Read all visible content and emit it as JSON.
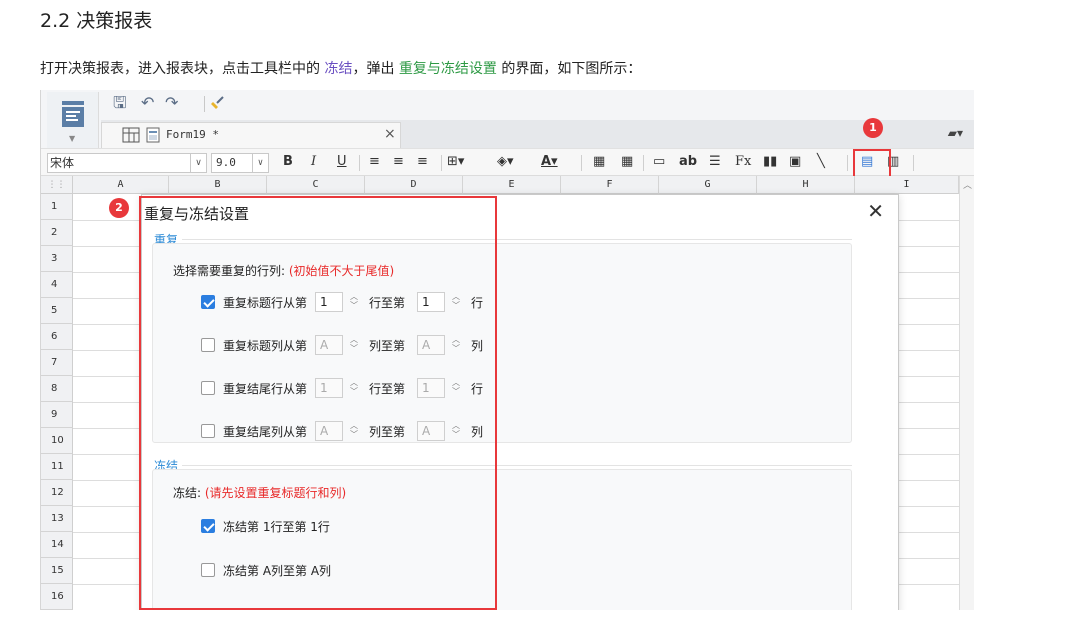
{
  "doc": {
    "title": "2.2 决策报表",
    "para_prefix": "打开决策报表，进入报表块，点击工具栏中的",
    "para_link1": "冻结",
    "para_mid": "，弹出",
    "para_link2": "重复与冻结设置",
    "para_suffix": "的界面，如下图所示："
  },
  "app": {
    "tab_label": "Form19 *",
    "font_name": "宋体",
    "font_size": "9.0",
    "columns": [
      "A",
      "B",
      "C",
      "D",
      "E",
      "F",
      "G",
      "H",
      "I"
    ],
    "rows": [
      "1",
      "2",
      "3",
      "4",
      "5",
      "6",
      "7",
      "8",
      "9",
      "10",
      "11",
      "12",
      "13",
      "14",
      "15",
      "16"
    ]
  },
  "badges": {
    "one": "1",
    "two": "2"
  },
  "dialog": {
    "title": "重复与冻结设置",
    "repeat": {
      "label": "重复",
      "hint": "选择需要重复的行列:",
      "hint_note": "(初始值不大于尾值)",
      "rows": [
        {
          "checked": true,
          "label": "重复标题行从第",
          "start": "1",
          "mid": "行至第",
          "end": "1",
          "unit": "行"
        },
        {
          "checked": false,
          "label": "重复标题列从第",
          "start": "A",
          "mid": "列至第",
          "end": "A",
          "unit": "列"
        },
        {
          "checked": false,
          "label": "重复结尾行从第",
          "start": "1",
          "mid": "行至第",
          "end": "1",
          "unit": "行"
        },
        {
          "checked": false,
          "label": "重复结尾列从第",
          "start": "A",
          "mid": "列至第",
          "end": "A",
          "unit": "列"
        }
      ]
    },
    "freeze": {
      "label": "冻结",
      "hint": "冻结:",
      "hint_note": "(请先设置重复标题行和列)",
      "rows": [
        {
          "checked": true,
          "label": "冻结第 1行至第 1行"
        },
        {
          "checked": false,
          "label": "冻结第 A列至第 A列"
        }
      ]
    }
  },
  "colors": {
    "highlight": "#e8383b",
    "section_blue": "#2b8ad6",
    "checkbox_blue": "#2b7ee0",
    "note_red": "#e82a2a"
  }
}
